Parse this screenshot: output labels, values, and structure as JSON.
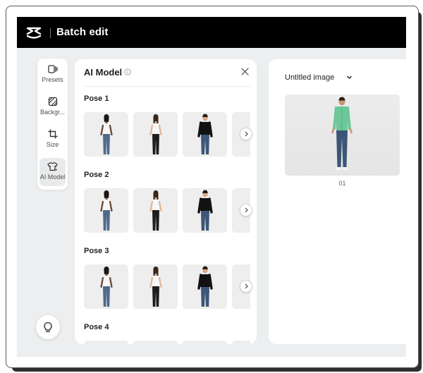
{
  "app": {
    "title": "Batch edit",
    "logo": "capcut-logo-icon"
  },
  "rail": {
    "items": [
      {
        "label": "Presets",
        "icon": "presets-icon",
        "active": false
      },
      {
        "label": "Backgr...",
        "icon": "background-icon",
        "active": false
      },
      {
        "label": "Size",
        "icon": "crop-icon",
        "active": false
      },
      {
        "label": "AI Model",
        "icon": "shirt-icon",
        "active": true
      }
    ],
    "help_icon": "lightbulb-icon"
  },
  "panel": {
    "title": "AI Model",
    "info_icon": "info-icon",
    "close_icon": "close-icon",
    "poses": [
      {
        "label": "Pose 1"
      },
      {
        "label": "Pose 2"
      },
      {
        "label": "Pose 3"
      },
      {
        "label": "Pose 4"
      }
    ]
  },
  "canvas": {
    "document_title": "Untitled image",
    "images": [
      {
        "caption": "01"
      }
    ]
  },
  "colors": {
    "titlebar": "#000000",
    "workspace": "#eceeef",
    "shirt_green": "#6cc79a",
    "jeans_blue": "#3b5677"
  }
}
